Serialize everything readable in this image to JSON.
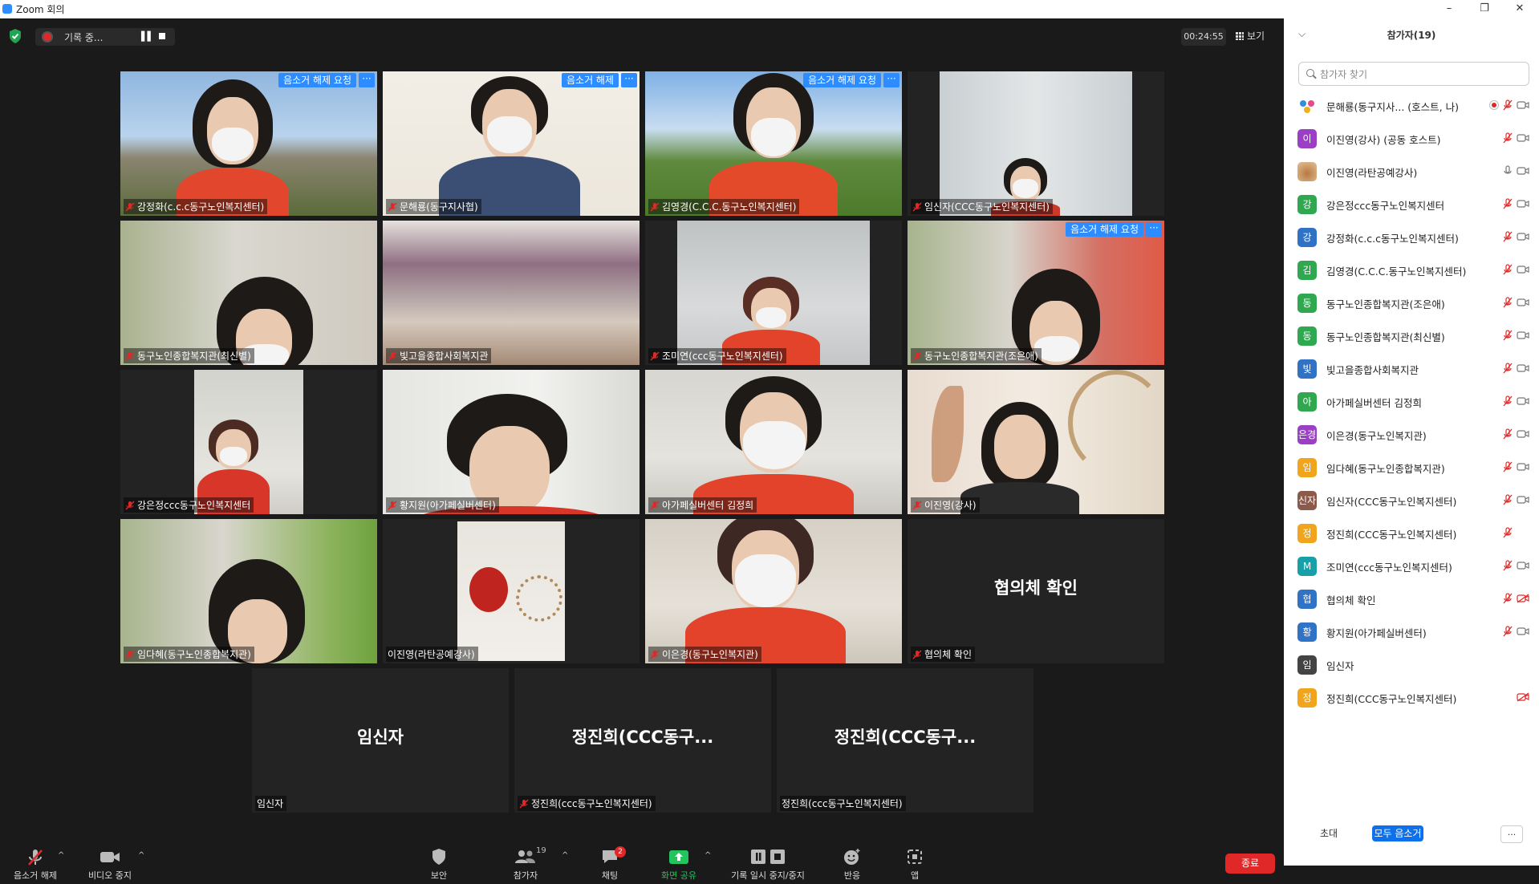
{
  "window": {
    "title": "Zoom 회의"
  },
  "topbar": {
    "rec_label": "기록 중...",
    "timer": "00:24:55",
    "view_label": "보기"
  },
  "tiles": [
    {
      "name": "강정화(c.c.c동구노인복지센터)",
      "badge": "음소거 해제 요청",
      "more": "···"
    },
    {
      "name": "문해룡(동구지사협)",
      "badge": "음소거 해제",
      "more": "···"
    },
    {
      "name": "김영경(C.C.C.동구노인복지센터)",
      "badge": "음소거 해제 요청",
      "more": "···"
    },
    {
      "name": "임신자(CCC동구노인복지센터)"
    },
    {
      "name": "동구노인종합복지관(최신별)"
    },
    {
      "name": "빛고을종합사회복지관"
    },
    {
      "name": "조미연(ccc동구노인복지센터)"
    },
    {
      "name": "동구노인종합복지관(조은애)",
      "badge": "음소거 해제 요청",
      "more": "···"
    },
    {
      "name": "강은정ccc동구노인복지센터"
    },
    {
      "name": "황지원(아가페실버센터)"
    },
    {
      "name": "아가페실버센터 김정희"
    },
    {
      "name": "이진영(강사)"
    },
    {
      "name": "임다혜(동구노인종합복지관)"
    },
    {
      "name": "이진영(라탄공예강사)"
    },
    {
      "name": "이은경(동구노인복지관)"
    },
    {
      "name": "협의체 확인",
      "big": "협의체 확인"
    },
    {
      "name": "임신자",
      "big": "임신자"
    },
    {
      "name": "정진희(ccc동구노인복지센터)",
      "big": "정진희(CCC동구..."
    },
    {
      "name": "정진희(ccc동구노인복지센터)",
      "big": "정진희(CCC동구..."
    }
  ],
  "toolbar": {
    "unmute": "음소거 해제",
    "stop_video": "비디오 중지",
    "security": "보안",
    "participants": "참가자",
    "participants_count": "19",
    "chat": "채팅",
    "chat_badge": "2",
    "share": "화면 공유",
    "record": "기록 일시 중지/중지",
    "reactions": "반응",
    "apps": "앱",
    "end": "종료"
  },
  "panel": {
    "title": "참가자(19)",
    "search_placeholder": "참가자 찾기",
    "invite": "초대",
    "mute_all": "모두 음소거",
    "more": "...",
    "participants": [
      {
        "initial": "",
        "name": "문해룡(동구지사... (호스트, 나)",
        "color": "#ffffff",
        "mic": "muted",
        "cam": "on"
      },
      {
        "initial": "이",
        "name": "이진영(강사) (공동 호스트)",
        "color": "#9b3fc6",
        "mic": "muted",
        "cam": "on"
      },
      {
        "initial": "",
        "name": "이진영(라탄공예강사)",
        "color": "#c49a6c",
        "mic": "on",
        "cam": "on"
      },
      {
        "initial": "강",
        "name": "강은정ccc동구노인복지센터",
        "color": "#2fa84f",
        "mic": "muted",
        "cam": "on"
      },
      {
        "initial": "강",
        "name": "강정화(c.c.c동구노인복지센터)",
        "color": "#2f72c6",
        "mic": "muted",
        "cam": "on"
      },
      {
        "initial": "김",
        "name": "김영경(C.C.C.동구노인복지센터)",
        "color": "#2fa84f",
        "mic": "muted",
        "cam": "on"
      },
      {
        "initial": "동",
        "name": "동구노인종합복지관(조은애)",
        "color": "#2fa84f",
        "mic": "muted",
        "cam": "on"
      },
      {
        "initial": "동",
        "name": "동구노인종합복지관(최신별)",
        "color": "#2fa84f",
        "mic": "muted",
        "cam": "on"
      },
      {
        "initial": "빛",
        "name": "빛고을종합사회복지관",
        "color": "#2f72c6",
        "mic": "muted",
        "cam": "on"
      },
      {
        "initial": "아",
        "name": "아가페실버센터 김정희",
        "color": "#2fa84f",
        "mic": "muted",
        "cam": "on"
      },
      {
        "initial": "은경",
        "name": "이은경(동구노인복지관)",
        "color": "#9b3fc6",
        "mic": "muted",
        "cam": "on"
      },
      {
        "initial": "임",
        "name": "임다혜(동구노인종합복지관)",
        "color": "#f0a51c",
        "mic": "muted",
        "cam": "on"
      },
      {
        "initial": "신자",
        "name": "임신자(CCC동구노인복지센터)",
        "color": "#8c5a4a",
        "mic": "muted",
        "cam": "on"
      },
      {
        "initial": "정",
        "name": "정진희(CCC동구노인복지센터)",
        "color": "#f0a51c",
        "mic": "muted",
        "cam": "none"
      },
      {
        "initial": "M",
        "name": "조미연(ccc동구노인복지센터)",
        "color": "#18a0a8",
        "mic": "muted",
        "cam": "on"
      },
      {
        "initial": "협",
        "name": "협의체 확인",
        "color": "#2f72c6",
        "mic": "muted",
        "cam": "off"
      },
      {
        "initial": "황",
        "name": "황지원(아가페실버센터)",
        "color": "#2f72c6",
        "mic": "muted",
        "cam": "on"
      },
      {
        "initial": "임",
        "name": "임신자",
        "color": "#444444",
        "mic": "none",
        "cam": "none"
      },
      {
        "initial": "정",
        "name": "정진희(CCC동구노인복지센터)",
        "color": "#f0a51c",
        "mic": "none",
        "cam": "off"
      }
    ]
  }
}
